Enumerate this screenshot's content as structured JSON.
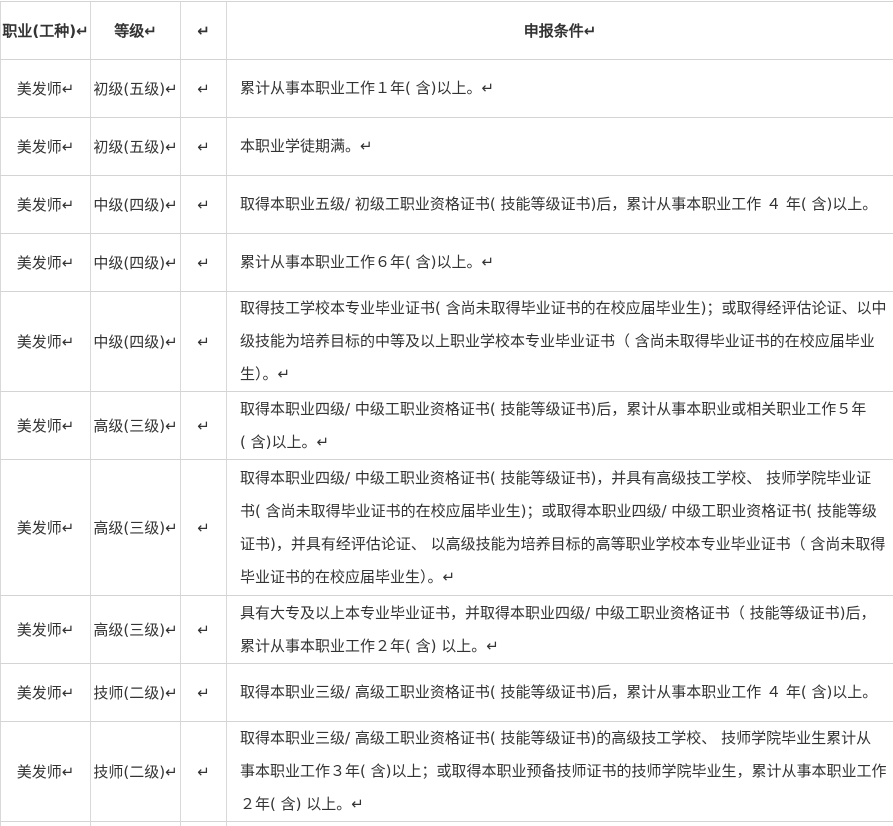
{
  "table": {
    "headers": [
      "职业(工种)↵",
      "等级↵",
      "↵",
      "申报条件↵"
    ],
    "rows": [
      {
        "occupation": "美发师↵",
        "level": "初级(五级)↵",
        "mark": "↵",
        "conditions": [
          "累计从事本职业工作１年( 含)以上。↵"
        ]
      },
      {
        "occupation": "美发师↵",
        "level": "初级(五级)↵",
        "mark": "↵",
        "conditions": [
          "本职业学徒期满。↵"
        ]
      },
      {
        "occupation": "美发师↵",
        "level": "中级(四级)↵",
        "mark": "↵",
        "conditions": [
          "取得本职业五级/ 初级工职业资格证书( 技能等级证书)后，累计从事本职业工作 ４ 年( 含)以上。"
        ]
      },
      {
        "occupation": "美发师↵",
        "level": "中级(四级)↵",
        "mark": "↵",
        "conditions": [
          "累计从事本职业工作６年( 含)以上。↵"
        ]
      },
      {
        "occupation": "美发师↵",
        "level": "中级(四级)↵",
        "mark": "↵",
        "conditions": [
          "取得技工学校本专业毕业证书( 含尚未取得毕业证书的在校应届毕业生)；或取得经评估论证、以中",
          "级技能为培养目标的中等及以上职业学校本专业毕业证书（ 含尚未取得毕业证书的在校应届毕业",
          "生）。↵"
        ]
      },
      {
        "occupation": "美发师↵",
        "level": "高级(三级)↵",
        "mark": "↵",
        "conditions": [
          "取得本职业四级/ 中级工职业资格证书( 技能等级证书)后，累计从事本职业或相关职业工作５年",
          "( 含)以上。↵"
        ]
      },
      {
        "occupation": "美发师↵",
        "level": "高级(三级)↵",
        "mark": "↵",
        "conditions": [
          "取得本职业四级/ 中级工职业资格证书( 技能等级证书)，并具有高级技工学校、 技师学院毕业证",
          "书( 含尚未取得毕业证书的在校应届毕业生)；或取得本职业四级/ 中级工职业资格证书( 技能等级",
          "证书)，并具有经评估论证、 以高级技能为培养目标的高等职业学校本专业毕业证书（ 含尚未取得",
          "毕业证书的在校应届毕业生）。↵"
        ]
      },
      {
        "occupation": "美发师↵",
        "level": "高级(三级)↵",
        "mark": "↵",
        "conditions": [
          "具有大专及以上本专业毕业证书，并取得本职业四级/ 中级工职业资格证书（ 技能等级证书)后，",
          "累计从事本职业工作２年( 含) 以上。↵"
        ]
      },
      {
        "occupation": "美发师↵",
        "level": "技师(二级)↵",
        "mark": "↵",
        "conditions": [
          "取得本职业三级/ 高级工职业资格证书( 技能等级证书)后，累计从事本职业工作 ４ 年( 含)以上。"
        ]
      },
      {
        "occupation": "美发师↵",
        "level": "技师(二级)↵",
        "mark": "↵",
        "conditions": [
          "取得本职业三级/ 高级工职业资格证书( 技能等级证书)的高级技工学校、 技师学院毕业生累计从",
          "事本职业工作３年( 含)以上；或取得本职业预备技师证书的技师学院毕业生，累计从事本职业工作",
          "２年( 含) 以上。↵"
        ]
      }
    ]
  }
}
